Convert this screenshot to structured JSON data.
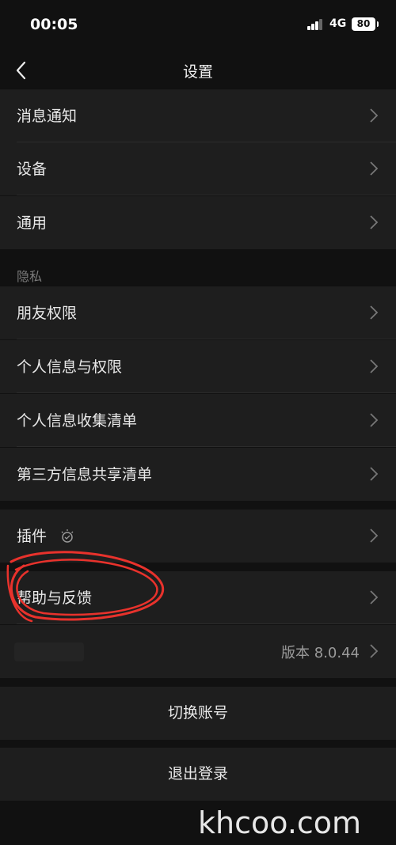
{
  "status_bar": {
    "time": "00:05",
    "network": "4G",
    "battery": "80"
  },
  "nav": {
    "title": "设置",
    "back_icon": "chevron-left-icon"
  },
  "group1": [
    {
      "label": "消息通知"
    },
    {
      "label": "设备"
    },
    {
      "label": "通用"
    }
  ],
  "privacy": {
    "section_label": "隐私",
    "items": [
      {
        "label": "朋友权限"
      },
      {
        "label": "个人信息与权限"
      },
      {
        "label": "个人信息收集清单"
      },
      {
        "label": "第三方信息共享清单"
      }
    ]
  },
  "plugins": {
    "label": "插件",
    "icon": "bulb-icon"
  },
  "help": {
    "label": "帮助与反馈"
  },
  "about": {
    "version": "版本 8.0.44"
  },
  "actions": {
    "switch_account": "切换账号",
    "logout": "退出登录"
  },
  "watermark": "khcoo.com",
  "colors": {
    "background": "#111111",
    "row": "#1e1e1e",
    "annotation": "#e8322c"
  }
}
